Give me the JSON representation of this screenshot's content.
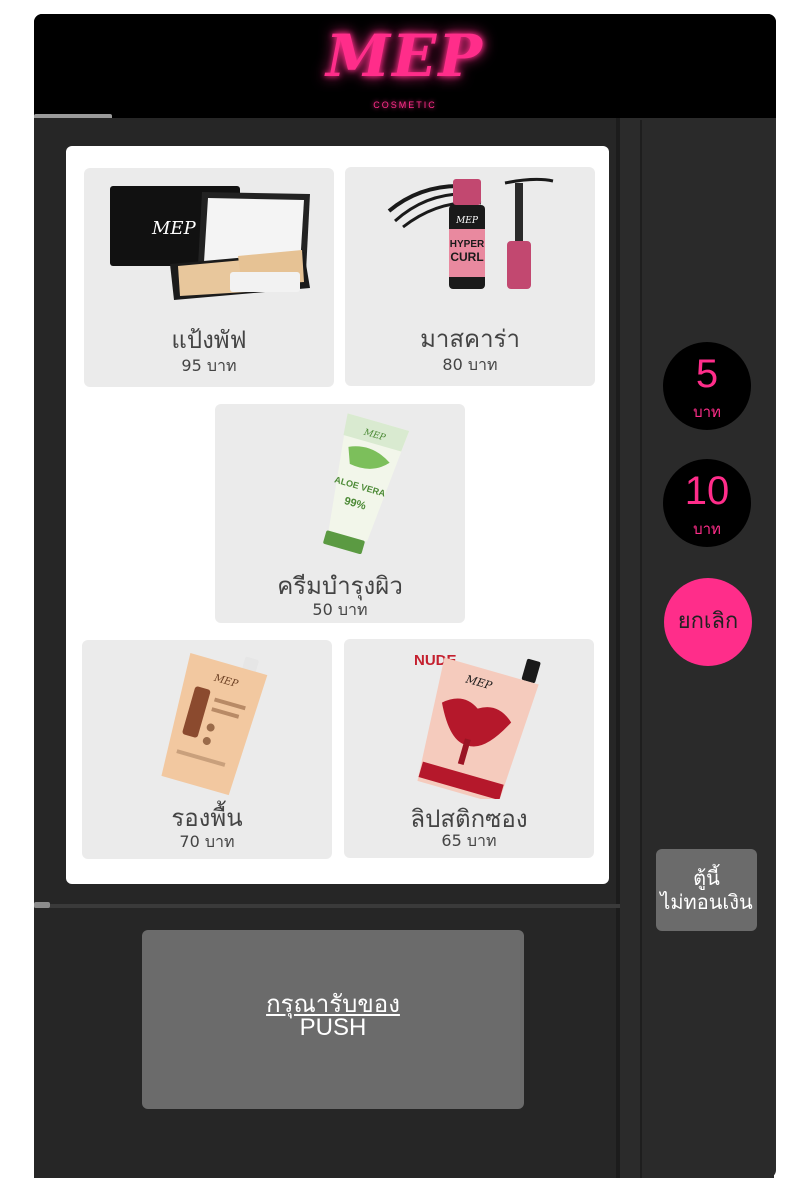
{
  "brand": {
    "logo": "MEP",
    "sub": "COSMETIC"
  },
  "products": [
    {
      "name": "แป้งพัฟ",
      "price": "95 บาท"
    },
    {
      "name": "มาสคาร่า",
      "price": "80 บาท"
    },
    {
      "name": "ครีมบำรุงผิว",
      "price": "50 บาท"
    },
    {
      "name": "รองพื้น",
      "price": "70 บาท"
    },
    {
      "name": "ลิปสติกซอง",
      "price": "65 บาท"
    }
  ],
  "coins": [
    {
      "amount": "5",
      "unit": "บาท"
    },
    {
      "amount": "10",
      "unit": "บาท"
    }
  ],
  "cancel_label": "ยกเลิก",
  "no_change": {
    "line1": "ตู้นี้",
    "line2": "ไม่ทอนเงิน"
  },
  "pickup": {
    "line1": "กรุณารับของ",
    "line2": "PUSH"
  },
  "product_labels": {
    "powder": "MEP",
    "mascara_brand": "MEP",
    "mascara_line1": "HYPER",
    "mascara_line2": "CURL",
    "aloe_brand": "MEP",
    "aloe_text": "ALOE VERA",
    "aloe_pct": "99%",
    "foundation_brand": "MEP",
    "lip_tag": "NUDE",
    "lip_brand": "MEP"
  },
  "colors": {
    "accent": "#ff2d8a",
    "body": "#2b2b2b",
    "header": "#000000",
    "card": "#ebebeb"
  }
}
